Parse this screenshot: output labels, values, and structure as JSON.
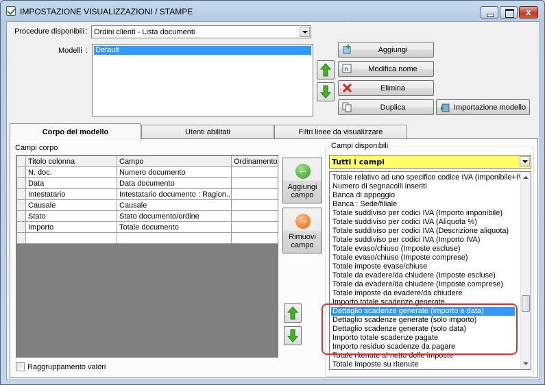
{
  "window": {
    "title": "IMPOSTAZIONE VISUALIZZAZIONI / STAMPE",
    "close_glyph": "x"
  },
  "procedures": {
    "label": "Procedure disponibili",
    "selected": "Ordini clienti - Lista documenti"
  },
  "models": {
    "label": "Modelli",
    "items": [
      "Default"
    ]
  },
  "model_buttons": {
    "add": "Aggiungi",
    "rename": "Modifica nome",
    "delete": "Elimina",
    "duplicate": "Duplica",
    "import": "Importazione modello"
  },
  "tabs": [
    "Corpo del modello",
    "Utenti abilitati",
    "Filtri linee da visualizzare"
  ],
  "body_fields": {
    "legend": "Campi corpo",
    "columns": [
      "Titolo colonna",
      "Campo",
      "Ordinamento"
    ],
    "rows": [
      [
        "N. doc.",
        "Numero documento",
        ""
      ],
      [
        "Data",
        "Data documento",
        ""
      ],
      [
        "Intestatario",
        "Intestatario documento : Ragion...",
        ""
      ],
      [
        "Causale",
        "Causale",
        ""
      ],
      [
        "Stato",
        "Stato documento/ordine",
        ""
      ],
      [
        "Importo",
        "Totale documento",
        ""
      ],
      [
        "",
        "",
        ""
      ]
    ]
  },
  "middle_buttons": {
    "add_field": "Aggiungi campo",
    "remove_field": "Rimuovi campo"
  },
  "available_fields": {
    "legend": "Campi disponibili",
    "filter": "Tutti i campi",
    "items": [
      "Totale relativo ad uno specifico codice IVA (Imponibile+IV",
      "Numero di segnacolli inseriti",
      "Banca di appoggio",
      "Banca : Sede/filiale",
      "Totale suddiviso per codici IVA (Importo imponibile)",
      "Totale suddiviso per codici IVA (Aliquota %)",
      "Totale suddiviso per codici IVA (Descrizione aliquota)",
      "Totale suddiviso per codici IVA (Importo IVA)",
      "Totale evaso/chiuso (Imposte escluse)",
      "Totale evaso/chiuso (Imposte comprese)",
      "Totale imposte evase/chiuse",
      "Totale da evadere/da chiudere (Imposte escluse)",
      "Totale da evadere/da chiudere (Imposte comprese)",
      "Totale imposte da evadere/da chiudere",
      "Importo totale scadenze generate",
      "Dettaglio scadenze generate (importo e data)",
      "Dettaglio scadenze generate (solo importo)",
      "Dettaglio scadenze generate (solo data)",
      "Importo totale scadenze pagate",
      "Importo residuo scadenze da pagare",
      "Totale ritenute al netto delle imposte",
      "Totale imposte su ritenute"
    ],
    "selected_index": 15
  },
  "grouping": {
    "label": "Raggruppamento valori",
    "checked": false
  },
  "icons": {
    "add": "add-icon",
    "rename": "rename-icon",
    "delete": "delete-icon",
    "duplicate": "duplicate-icon",
    "import": "import-icon"
  }
}
